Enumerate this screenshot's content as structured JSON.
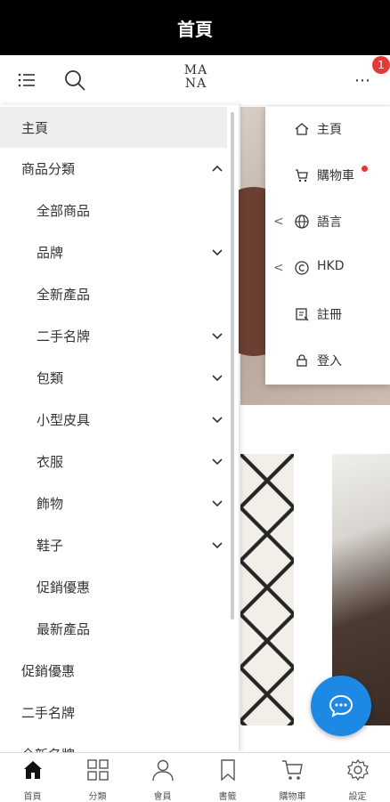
{
  "title": "首頁",
  "header": {
    "logo_text_1": "MA",
    "logo_text_2": "NA",
    "more_label": "⋯",
    "badge_count": "1"
  },
  "drawer": {
    "items": [
      {
        "label": "主頁"
      },
      {
        "label": "商品分類"
      },
      {
        "label": "全部商品"
      },
      {
        "label": "品牌"
      },
      {
        "label": "全新產品"
      },
      {
        "label": "二手名牌"
      },
      {
        "label": "包類"
      },
      {
        "label": "小型皮具"
      },
      {
        "label": "衣服"
      },
      {
        "label": "飾物"
      },
      {
        "label": "鞋子"
      },
      {
        "label": "促銷優惠"
      },
      {
        "label": "最新產品"
      },
      {
        "label": "促銷優惠"
      },
      {
        "label": "二手名牌"
      },
      {
        "label": "全新名牌"
      }
    ]
  },
  "dropdown": {
    "items": [
      {
        "label": "主頁",
        "icon": "home-icon"
      },
      {
        "label": "購物車",
        "icon": "cart-icon"
      },
      {
        "label": "語言",
        "icon": "globe-icon"
      },
      {
        "label": "HKD",
        "icon": "currency-icon"
      },
      {
        "label": "註冊",
        "icon": "register-icon"
      },
      {
        "label": "登入",
        "icon": "lock-icon"
      }
    ]
  },
  "bottom_nav": [
    {
      "label": "首頁"
    },
    {
      "label": "分類"
    },
    {
      "label": "會員"
    },
    {
      "label": "書籤"
    },
    {
      "label": "購物車"
    },
    {
      "label": "設定"
    }
  ],
  "colors": {
    "accent": "#1e88e5",
    "badge": "#e53935",
    "titlebar": "#000000"
  }
}
